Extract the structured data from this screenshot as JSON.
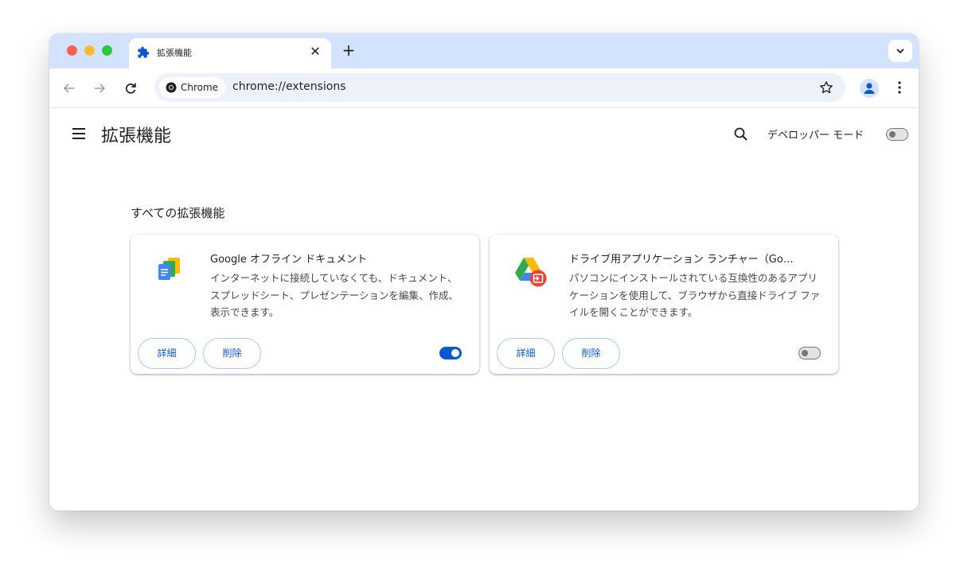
{
  "tab": {
    "title": "拡張機能",
    "close": "✕",
    "new_tab": "+"
  },
  "omnibox": {
    "chip_label": "Chrome",
    "url": "chrome://extensions"
  },
  "header": {
    "title": "拡張機能",
    "dev_mode_label": "デベロッパー モード",
    "dev_mode_on": false
  },
  "section": {
    "title": "すべての拡張機能"
  },
  "extensions": [
    {
      "name": "Google オフライン ドキュメント",
      "description": "インターネットに接続していなくても、ドキュメント、スプレッドシート、プレゼンテーションを編集、作成、表示できます。",
      "details_label": "詳細",
      "remove_label": "削除",
      "enabled": true,
      "icon": "google-docs-offline-icon"
    },
    {
      "name": "ドライブ用アプリケーション ランチャー（Go…",
      "description": "パソコンにインストールされている互換性のあるアプリケーションを使用して、ブラウザから直接ドライブ ファイルを開くことができます。",
      "details_label": "詳細",
      "remove_label": "削除",
      "enabled": false,
      "icon": "drive-app-launcher-icon"
    }
  ],
  "colors": {
    "accent": "#0b57d0",
    "tabstrip": "#d3e3fd",
    "omnibox": "#edf2fa"
  }
}
